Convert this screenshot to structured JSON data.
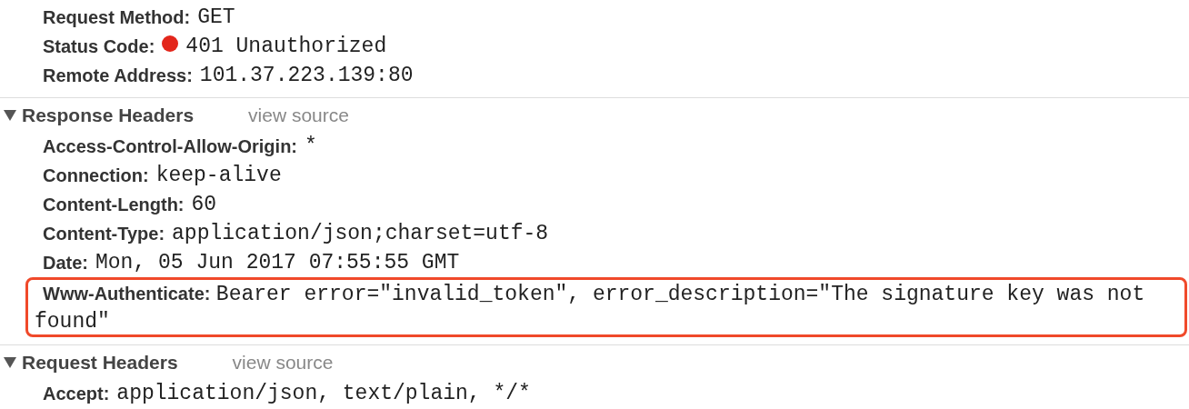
{
  "general": {
    "rows": [
      {
        "name": "Request Method:",
        "value": "GET"
      },
      {
        "name": "Status Code:",
        "value": "401 Unauthorized",
        "color": "#e3261b"
      },
      {
        "name": "Remote Address:",
        "value": "101.37.223.139:80"
      }
    ]
  },
  "sections": [
    {
      "title": "Response Headers",
      "link": "view source",
      "expanded": true,
      "rows": [
        {
          "name": "Access-Control-Allow-Origin:",
          "value": "*",
          "highlighted": false
        },
        {
          "name": "Connection:",
          "value": "keep-alive",
          "highlighted": false
        },
        {
          "name": "Content-Length:",
          "value": "60",
          "highlighted": false
        },
        {
          "name": "Content-Type:",
          "value": "application/json;charset=utf-8",
          "highlighted": false
        },
        {
          "name": "Date:",
          "value": "Mon, 05 Jun 2017 07:55:55 GMT",
          "highlighted": false
        },
        {
          "name": "Www-Authenticate:",
          "value": "Bearer error=\"invalid_token\", error_description=\"The signature key was not found\"",
          "highlighted": true
        }
      ]
    },
    {
      "title": "Request Headers",
      "link": "view source",
      "expanded": true,
      "rows": [
        {
          "name": "Accept:",
          "value": "application/json, text/plain, */*",
          "highlighted": false
        }
      ]
    }
  ]
}
